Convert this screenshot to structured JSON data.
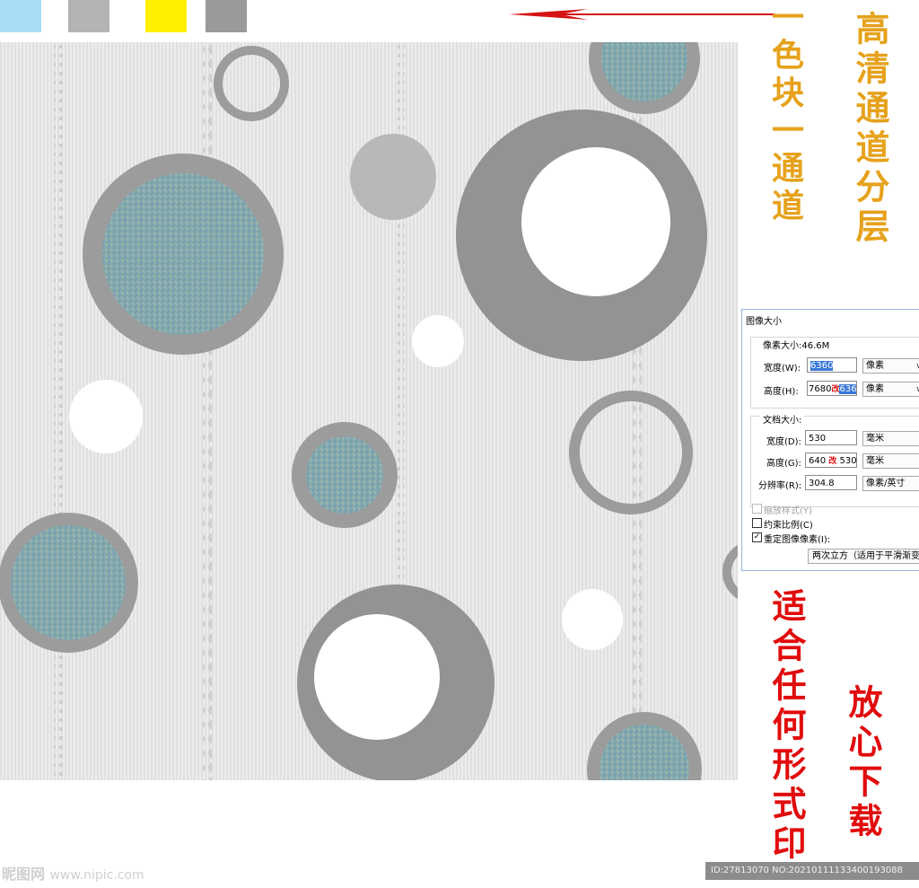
{
  "color_swatches": [
    {
      "name": "light-blue",
      "color": "#a9dcf5"
    },
    {
      "name": "light-gray",
      "color": "#b4b4b4"
    },
    {
      "name": "yellow",
      "color": "#fff000"
    },
    {
      "name": "gray",
      "color": "#9a9a9a"
    }
  ],
  "arrow": {
    "color": "#d41414",
    "direction": "left"
  },
  "captions": {
    "color_block_channel": "一色块一通道",
    "hd_channel_layers": "高清通道分层",
    "suitable_any_print": "适合任何形式印",
    "download_freely": "放心下载"
  },
  "dialog": {
    "title": "图像大小",
    "pixel_dimensions": {
      "label": "像素大小:46.6M",
      "width_label": "宽度(W):",
      "width_value": "6360",
      "width_unit": "像素",
      "height_label": "高度(H):",
      "height_value_old": "7680",
      "height_annotation": "改",
      "height_value_new": "6360",
      "height_unit": "像素"
    },
    "document_size": {
      "label": "文档大小:",
      "width_label": "宽度(D):",
      "width_value": "530",
      "width_unit": "毫米",
      "height_label": "高度(G):",
      "height_value_old": "640",
      "height_annotation": "改",
      "height_value_new": "530",
      "height_unit": "毫米",
      "resolution_label": "分辨率(R):",
      "resolution_value": "304.8",
      "resolution_unit": "像素/英寸"
    },
    "scale_styles": {
      "label": "缩放样式(Y)",
      "checked": false,
      "disabled": true
    },
    "constrain_proportions": {
      "label": "约束比例(C)",
      "checked": false
    },
    "resample": {
      "label": "重定图像像素(I):",
      "checked": true
    },
    "resample_method": "两次立方（适用于平滑渐变"
  },
  "watermark": {
    "brand": "昵图网",
    "site": "www.nipic.com"
  },
  "id_bar": "ID:27813070 NO:20210111133400193088",
  "pattern": {
    "background": "#ececec",
    "ring_color": "#9c9c9c",
    "fill_teal": "#7fa8b0",
    "white": "#ffffff"
  }
}
